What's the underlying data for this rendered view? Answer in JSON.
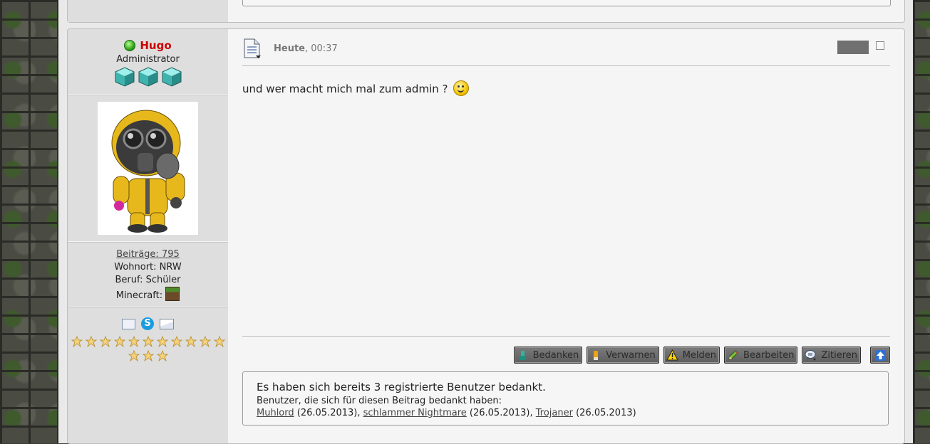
{
  "colors": {
    "username": "#cc0000",
    "online": "#2fa31a",
    "button_bg": "#6a6a6a"
  },
  "author": {
    "name": "Hugo",
    "rank": "Administrator",
    "stars": 3,
    "posts_label": "Beiträge: 795",
    "location": "Wohnort: NRW",
    "job": "Beruf: Schüler",
    "minecraft_label": "Minecraft:",
    "awards_count": 14,
    "contact_icons": [
      "profile-card-icon",
      "skype-icon",
      "email-icon"
    ]
  },
  "post": {
    "date_day": "Heute",
    "date_time": ", 00:37",
    "message": "und wer macht mich mal zum admin ?"
  },
  "actions": [
    {
      "label": "Bedanken",
      "icon": "thanks-icon"
    },
    {
      "label": "Verwarnen",
      "icon": "warn-icon"
    },
    {
      "label": "Melden",
      "icon": "report-icon"
    },
    {
      "label": "Bearbeiten",
      "icon": "edit-icon"
    },
    {
      "label": "Zitieren",
      "icon": "quote-icon"
    }
  ],
  "thanks": {
    "title": "Es haben sich bereits 3 registrierte Benutzer bedankt.",
    "subtitle": "Benutzer, die sich für diesen Beitrag bedankt haben:",
    "users": [
      {
        "name": "Muhlord",
        "date": " (26.05.2013), "
      },
      {
        "name": "schlammer Nightmare",
        "date": " (26.05.2013), "
      },
      {
        "name": "Trojaner",
        "date": " (26.05.2013)"
      }
    ]
  }
}
